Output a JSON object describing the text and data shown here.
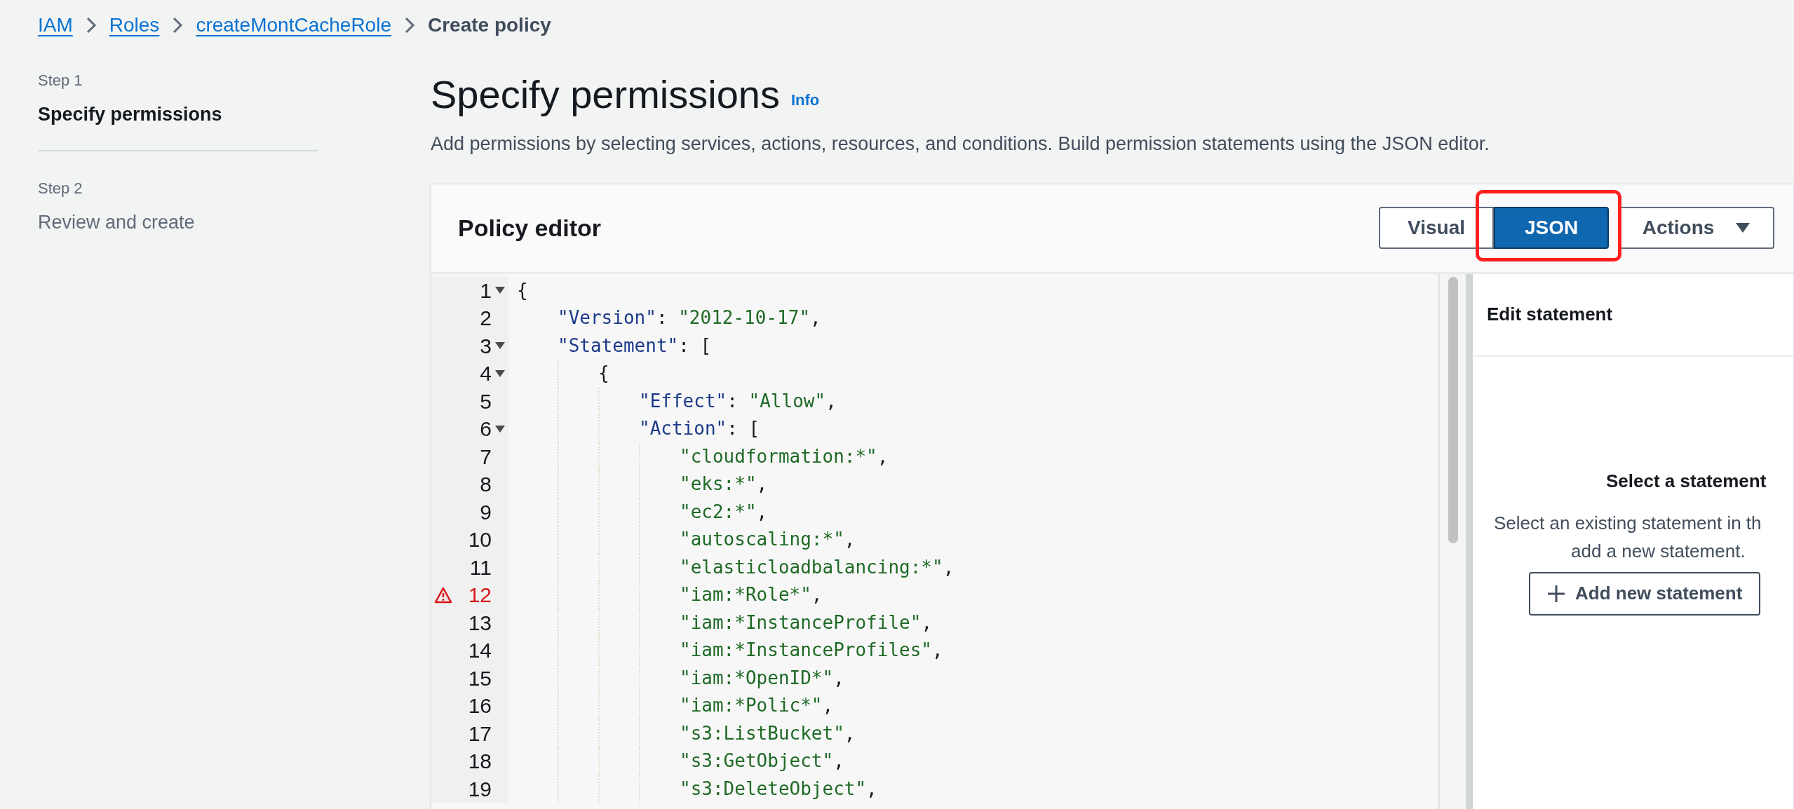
{
  "breadcrumb": {
    "links": [
      "IAM",
      "Roles",
      "createMontCacheRole"
    ],
    "current": "Create policy"
  },
  "steps": [
    {
      "step": "Step 1",
      "title": "Specify permissions",
      "selected": true
    },
    {
      "step": "Step 2",
      "title": "Review and create",
      "selected": false
    }
  ],
  "page": {
    "title": "Specify permissions",
    "info": "Info",
    "description": "Add permissions by selecting services, actions, resources, and conditions. Build permission statements using the JSON editor."
  },
  "editor": {
    "title": "Policy editor",
    "modes": [
      {
        "label": "Visual",
        "selected": false
      },
      {
        "label": "JSON",
        "selected": true
      }
    ],
    "actions": "Actions",
    "lines": [
      {
        "number": "1",
        "text": "{",
        "warning": false,
        "children": [
          {
            "number": "2",
            "text": "\"Version\": \"2012-10-17\",",
            "warning": false
          },
          {
            "number": "3",
            "text": "\"Statement\": [",
            "warning": false,
            "children": [
              {
                "number": "4",
                "text": "{",
                "warning": false,
                "children": [
                  {
                    "number": "5",
                    "text": "\"Effect\": \"Allow\",",
                    "warning": false
                  },
                  {
                    "number": "6",
                    "text": "\"Action\": [",
                    "warning": false,
                    "children": [
                      {
                        "number": "7",
                        "text": "\"cloudformation:*\",",
                        "warning": false
                      },
                      {
                        "number": "8",
                        "text": "\"eks:*\",",
                        "warning": false
                      },
                      {
                        "number": "9",
                        "text": "\"ec2:*\",",
                        "warning": false
                      },
                      {
                        "number": "10",
                        "text": "\"autoscaling:*\",",
                        "warning": false
                      },
                      {
                        "number": "11",
                        "text": "\"elasticloadbalancing:*\",",
                        "warning": false
                      },
                      {
                        "number": "12",
                        "text": "\"iam:*Role*\",",
                        "warning": true
                      },
                      {
                        "number": "13",
                        "text": "\"iam:*InstanceProfile\",",
                        "warning": false
                      },
                      {
                        "number": "14",
                        "text": "\"iam:*InstanceProfiles\",",
                        "warning": false
                      },
                      {
                        "number": "15",
                        "text": "\"iam:*OpenID*\",",
                        "warning": false
                      },
                      {
                        "number": "16",
                        "text": "\"iam:*Polic*\",",
                        "warning": false
                      },
                      {
                        "number": "17",
                        "text": "\"s3:ListBucket\",",
                        "warning": false
                      },
                      {
                        "number": "18",
                        "text": "\"s3:GetObject\",",
                        "warning": false
                      },
                      {
                        "number": "19",
                        "text": "\"s3:DeleteObject\",",
                        "warning": false
                      }
                    ]
                  }
                ]
              }
            ]
          }
        ]
      }
    ]
  },
  "statement_panel": {
    "title": "Edit statement",
    "empty_title": "Select a statement",
    "empty_text": [
      "Select an existing statement in th",
      "add a new statement."
    ],
    "add_button": "Add new statement"
  }
}
